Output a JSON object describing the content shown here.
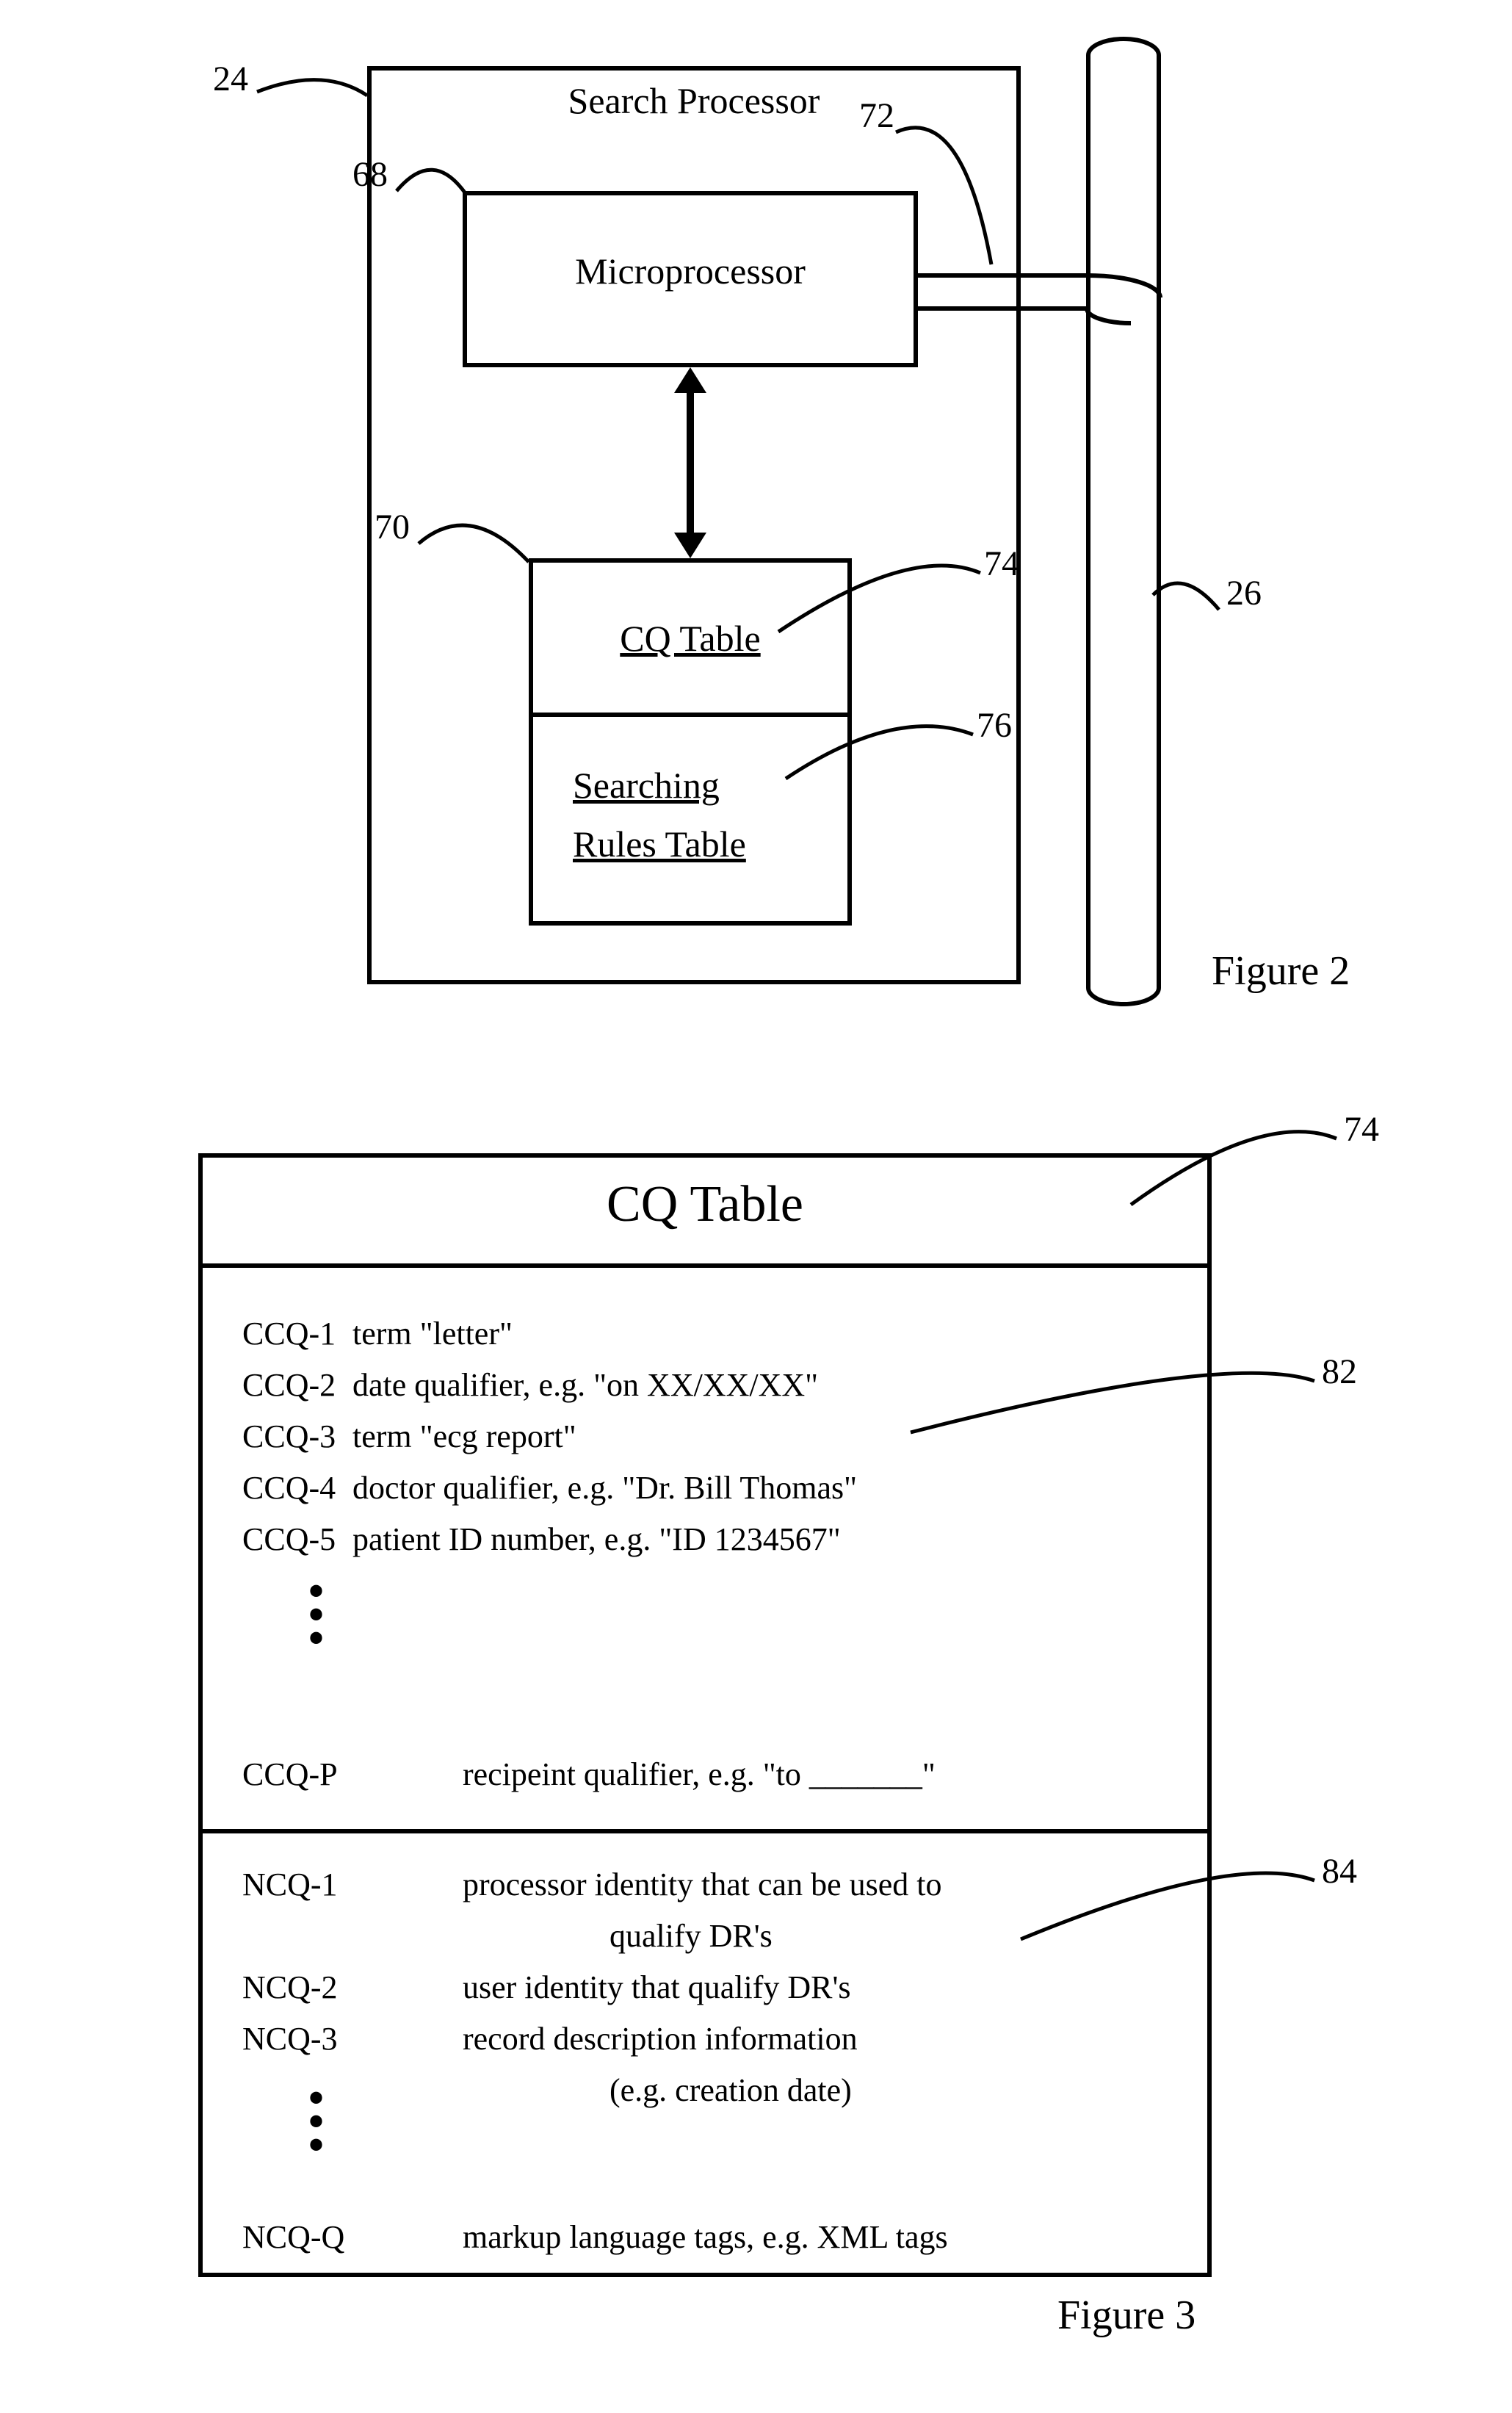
{
  "fig2": {
    "title": "Search Processor",
    "microprocessor": "Microprocessor",
    "cq_table": "CQ Table",
    "searching_rules1": "Searching",
    "searching_rules2": "Rules Table",
    "labels": {
      "l24": "24",
      "l68": "68",
      "l70": "70",
      "l72": "72",
      "l74": "74",
      "l76": "76",
      "l26": "26"
    },
    "caption": "Figure 2"
  },
  "fig3": {
    "title": "CQ Table",
    "labels": {
      "l74": "74",
      "l82": "82",
      "l84": "84"
    },
    "ccq": {
      "c1k": "CCQ-1",
      "c1v": "term \"letter\"",
      "c2k": "CCQ-2",
      "c2v": "date qualifier, e.g. \"on XX/XX/XX\"",
      "c3k": "CCQ-3",
      "c3v": "term \"ecg report\"",
      "c4k": "CCQ-4",
      "c4v": "doctor qualifier, e.g. \"Dr. Bill Thomas\"",
      "c5k": "CCQ-5",
      "c5v": "patient ID number, e.g. \"ID 1234567\"",
      "cpk": "CCQ-P",
      "cpv": "recipeint qualifier, e.g. \"to _______\""
    },
    "ncq": {
      "n1k": "NCQ-1",
      "n1v1": "processor identity that can be used to",
      "n1v2": "qualify DR's",
      "n2k": "NCQ-2",
      "n2v": "user identity that qualify DR's",
      "n3k": "NCQ-3",
      "n3v1": "record description information",
      "n3v2": "(e.g. creation date)",
      "nqk": "NCQ-Q",
      "nqv": "markup language tags, e.g. XML tags"
    },
    "caption": "Figure 3"
  }
}
